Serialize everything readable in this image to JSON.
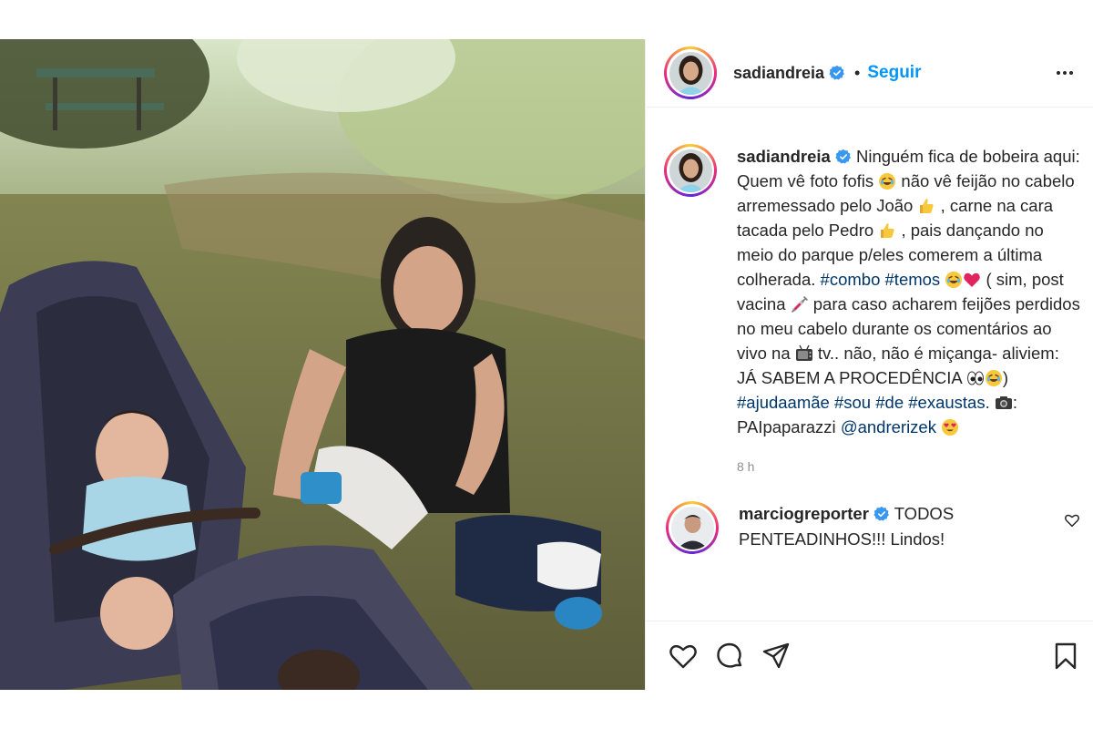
{
  "post": {
    "author": "sadiandreia",
    "follow_label": "Seguir",
    "separator": "•",
    "caption_segments": {
      "p1": "Ninguém fica de bobeira aqui: Quem vê foto fofis ",
      "p2": " não vê feijão no cabelo arremessado pelo João ",
      "p3": " , carne na cara tacada pelo Pedro ",
      "p4": " , pais dançando no meio do parque p/eles comerem a última colherada. ",
      "tag_combo": "#combo",
      "tag_temos": "#temos",
      "p5": " ( sim, post vacina ",
      "p6": " para caso acharem feijões perdidos no meu cabelo durante os comentários ao vivo na ",
      "p7": " tv.. não, não é miçanga- aliviem: JÁ SABEM A PROCEDÊNCIA ",
      "p8": ")",
      "tag_ajuda": "#ajudaamãe",
      "tag_sou": "#sou",
      "tag_de": "#de",
      "tag_exaustas": "#exaustas.",
      "p9": ": PAIpaparazzi ",
      "mention": "@andrerizek"
    },
    "time": "8 h"
  },
  "comment": {
    "author": "marciogreporter",
    "text": "TODOS PENTEADINHOS!!! Lindos!"
  },
  "icons": {
    "verified": "verified-badge-icon",
    "more": "more-options-icon",
    "like": "heart-icon",
    "comment": "comment-icon",
    "share": "share-icon",
    "save": "bookmark-icon"
  },
  "colors": {
    "link": "#0095f6",
    "hashtag": "#00376b",
    "verified": "#3897f0",
    "muted": "#8e8e8e"
  }
}
